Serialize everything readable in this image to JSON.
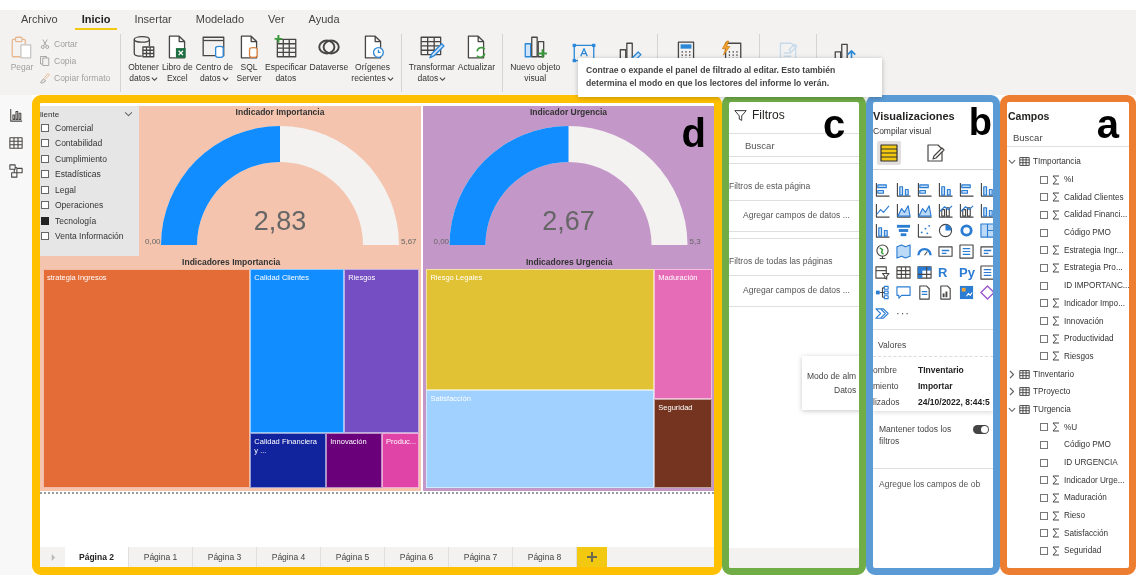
{
  "menu_tabs": [
    {
      "label": "Archivo",
      "selected": false
    },
    {
      "label": "Inicio",
      "selected": true
    },
    {
      "label": "Insertar",
      "selected": false
    },
    {
      "label": "Modelado",
      "selected": false
    },
    {
      "label": "Ver",
      "selected": false
    },
    {
      "label": "Ayuda",
      "selected": false
    }
  ],
  "ribbon": {
    "groups": [
      {
        "buttons": [
          {
            "label": "Pegar",
            "kind": "large",
            "disabled": true,
            "dropdown": false
          },
          {
            "label": "Cortar",
            "kind": "small",
            "disabled": true
          },
          {
            "label": "Copia",
            "kind": "small",
            "disabled": true
          },
          {
            "label": "Copiar formato",
            "kind": "small",
            "disabled": true
          }
        ]
      },
      {
        "buttons": [
          {
            "label": "Obtener\ndatos",
            "kind": "large",
            "disabled": false,
            "dropdown": true
          },
          {
            "label": "Libro de\nExcel",
            "kind": "large",
            "disabled": false,
            "dropdown": false
          },
          {
            "label": "Centro de\ndatos",
            "kind": "large",
            "disabled": false,
            "dropdown": true
          },
          {
            "label": "SQL\nServer",
            "kind": "large",
            "disabled": false,
            "dropdown": false
          },
          {
            "label": "Especificar\ndatos",
            "kind": "large",
            "disabled": false,
            "dropdown": false
          },
          {
            "label": "Dataverse",
            "kind": "large",
            "disabled": false,
            "dropdown": false
          },
          {
            "label": "Orígenes\nrecientes",
            "kind": "large",
            "disabled": false,
            "dropdown": true
          }
        ]
      },
      {
        "buttons": [
          {
            "label": "Transformar\ndatos",
            "kind": "large",
            "disabled": false,
            "dropdown": true
          },
          {
            "label": "Actualizar",
            "kind": "large",
            "disabled": false,
            "dropdown": false
          }
        ]
      },
      {
        "buttons": [
          {
            "label": "Nuevo objeto\nvisual",
            "kind": "large",
            "disabled": false,
            "dropdown": false
          },
          {
            "kind": "icon",
            "disabled": false
          },
          {
            "kind": "icon",
            "disabled": false
          }
        ]
      },
      {
        "buttons": [
          {
            "kind": "icon",
            "disabled": false
          },
          {
            "kind": "icon",
            "disabled": false
          }
        ]
      },
      {
        "buttons": [
          {
            "kind": "icon",
            "disabled": true
          }
        ]
      },
      {
        "buttons": [
          {
            "kind": "icon",
            "disabled": false
          }
        ]
      }
    ]
  },
  "tooltip": "Contrae o expande el panel de filtrado al editar. Esto también determina el modo en que los lectores del informe lo verán.",
  "report": {
    "callout": "d",
    "slicer": {
      "title": "liente",
      "items": [
        {
          "label": "Comercial",
          "checked": false
        },
        {
          "label": "Contabilidad",
          "checked": false
        },
        {
          "label": "Cumplimiento",
          "checked": false
        },
        {
          "label": "Estadísticas",
          "checked": false
        },
        {
          "label": "Legal",
          "checked": false
        },
        {
          "label": "Operaciones",
          "checked": false
        },
        {
          "label": "Tecnología",
          "checked": true
        },
        {
          "label": "Venta Información",
          "checked": false
        }
      ]
    },
    "gauges": [
      {
        "title": "Indicador Importancia",
        "value": "2,83",
        "min": "0,00",
        "max": "5,67"
      },
      {
        "title": "Indicador Urgencia",
        "value": "2,67",
        "min": "0,00",
        "max": "5,3"
      }
    ],
    "treemaps": [
      {
        "title": "Indicadores Importancia",
        "tiles": [
          {
            "label": "strategia Ingresos",
            "color": "#e46c37"
          },
          {
            "label": "Calidad Clientes",
            "color": "#118dff"
          },
          {
            "label": "Riesgos",
            "color": "#744ec2"
          },
          {
            "label": "Calidad Financiera y ...",
            "color": "#12239e"
          },
          {
            "label": "Innovación",
            "color": "#6b007b"
          },
          {
            "label": "Produc...",
            "color": "#e044a7"
          }
        ]
      },
      {
        "title": "Indicadores Urgencia",
        "tiles": [
          {
            "label": "Riesgo Legales",
            "color": "#e0c234"
          },
          {
            "label": "Satisfacción",
            "color": "#a0d1ff"
          },
          {
            "label": "Maduración",
            "color": "#e66cb8"
          },
          {
            "label": "Seguridad",
            "color": "#743420"
          }
        ]
      }
    ],
    "page_tabs": [
      {
        "label": "Página 2",
        "selected": true
      },
      {
        "label": "Página 1",
        "selected": false
      },
      {
        "label": "Página 3",
        "selected": false
      },
      {
        "label": "Página 4",
        "selected": false
      },
      {
        "label": "Página 5",
        "selected": false
      },
      {
        "label": "Página 6",
        "selected": false
      },
      {
        "label": "Página 7",
        "selected": false
      },
      {
        "label": "Página 8",
        "selected": false
      }
    ]
  },
  "filters": {
    "callout": "c",
    "title": "Filtros",
    "search": {
      "placeholder": "Buscar"
    },
    "sections": [
      {
        "title": "Filtros de esta página",
        "hint": "Agregar campos de datos ..."
      },
      {
        "title": "Filtros de todas las páginas",
        "hint": "Agregar campos de datos ..."
      }
    ],
    "popup": [
      "Modo de alm",
      "Datos"
    ]
  },
  "visualizations": {
    "callout": "b",
    "title": "Visualizaciones",
    "subtitle": "Compilar visual",
    "build_tabs": [
      {
        "selected": true
      },
      {
        "selected": false
      }
    ],
    "script_visuals": [
      "R",
      "Py"
    ],
    "more": "···",
    "section": "Valores",
    "info_rows": [
      {
        "label": "ombre",
        "value": "TInventario"
      },
      {
        "label": "miento",
        "value": "Importar"
      },
      {
        "label": "lizados",
        "value": "24/10/2022, 8:44:5"
      }
    ],
    "toggle": {
      "label": "Mantener todos los filtros",
      "on": true
    },
    "drop_hint": "Agregue los campos de ob"
  },
  "fields": {
    "callout": "a",
    "title": "Campos",
    "search": {
      "placeholder": "Buscar"
    },
    "tables": [
      {
        "name": "TImportancia",
        "expanded": true,
        "children": [
          {
            "name": "%I",
            "kind": "measure",
            "checked": false
          },
          {
            "name": "Calidad Clientes",
            "kind": "measure",
            "checked": false
          },
          {
            "name": "Calidad Financi...",
            "kind": "measure",
            "checked": false
          },
          {
            "name": "Código PMO",
            "kind": "plain",
            "checked": false
          },
          {
            "name": "Estrategia Ingr...",
            "kind": "measure",
            "checked": false
          },
          {
            "name": "Estrategia Pro...",
            "kind": "measure",
            "checked": false
          },
          {
            "name": "ID IMPORTANC...",
            "kind": "plain",
            "checked": false
          },
          {
            "name": "Indicador Impo...",
            "kind": "measure",
            "checked": false
          },
          {
            "name": "Innovación",
            "kind": "measure",
            "checked": false
          },
          {
            "name": "Productividad",
            "kind": "measure",
            "checked": false
          },
          {
            "name": "Riesgos",
            "kind": "measure",
            "checked": false
          }
        ]
      },
      {
        "name": "TInventario",
        "expanded": false
      },
      {
        "name": "TProyecto",
        "expanded": false
      },
      {
        "name": "TUrgencia",
        "expanded": true,
        "children": [
          {
            "name": "%U",
            "kind": "measure",
            "checked": false
          },
          {
            "name": "Código PMO",
            "kind": "plain",
            "checked": false
          },
          {
            "name": "ID URGENCIA",
            "kind": "plain",
            "checked": false
          },
          {
            "name": "Indicador Urge...",
            "kind": "measure",
            "checked": false
          },
          {
            "name": "Maduración",
            "kind": "measure",
            "checked": false
          },
          {
            "name": "Rieso",
            "kind": "measure",
            "checked": false
          },
          {
            "name": "Satisfacción",
            "kind": "measure",
            "checked": false
          },
          {
            "name": "Seguridad",
            "kind": "measure",
            "checked": false
          }
        ]
      }
    ]
  }
}
